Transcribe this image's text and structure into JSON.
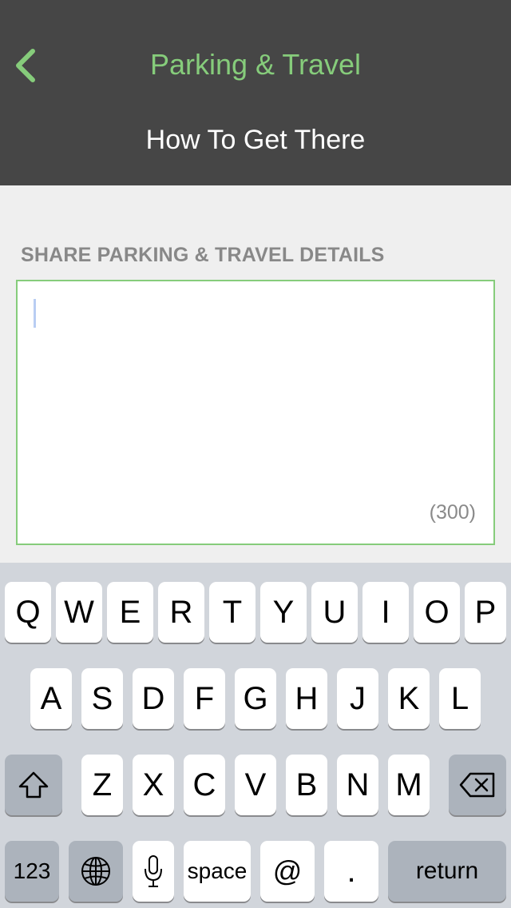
{
  "header": {
    "title": "Parking & Travel",
    "subtitle": "How To Get There"
  },
  "form": {
    "section_label": "SHARE PARKING & TRAVEL DETAILS",
    "details_value": "",
    "char_count": "(300)"
  },
  "keyboard": {
    "row1": [
      "Q",
      "W",
      "E",
      "R",
      "T",
      "Y",
      "U",
      "I",
      "O",
      "P"
    ],
    "row2": [
      "A",
      "S",
      "D",
      "F",
      "G",
      "H",
      "J",
      "K",
      "L"
    ],
    "row3": [
      "Z",
      "X",
      "C",
      "V",
      "B",
      "N",
      "M"
    ],
    "numbers_key": "123",
    "space_key": "space",
    "at_key": "@",
    "period_key": ".",
    "return_key": "return",
    "shift_icon": "shift-icon",
    "backspace_icon": "backspace-icon",
    "globe_icon": "globe-icon",
    "mic_icon": "microphone-icon"
  },
  "colors": {
    "header_bg": "#464646",
    "accent": "#86cc7b",
    "page_bg": "#efefef",
    "keyboard_bg": "#d1d5db"
  }
}
